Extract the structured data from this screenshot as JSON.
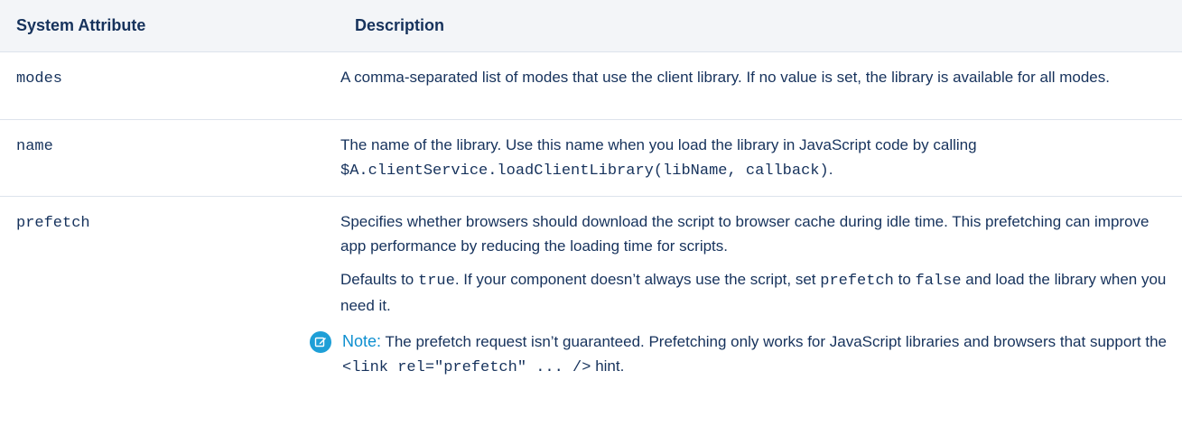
{
  "table": {
    "headers": {
      "attribute": "System Attribute",
      "description": "Description"
    },
    "rows": [
      {
        "attribute": "modes",
        "description": "A comma-separated list of modes that use the client library. If no value is set, the library is available for all modes."
      },
      {
        "attribute": "name",
        "description_text": "The name of the library. Use this name when you load the library in JavaScript code by calling",
        "description_code": "$A.clientService.loadClientLibrary(libName, callback)",
        "description_end": "."
      },
      {
        "attribute": "prefetch",
        "paragraph1": "Specifies whether browsers should download the script to browser cache during idle time. This prefetching can improve app performance by reducing the loading time for scripts.",
        "paragraph2": {
          "text_a": "Defaults to",
          "code_a": "true",
          "text_b": ". If your component doesn’t always use the script, set",
          "code_b": "prefetch",
          "text_c": "to",
          "code_c": "false",
          "text_d": "and load the library when you need it."
        },
        "note": {
          "icon": "note-edit-icon",
          "icon_color": "#1e9fd7",
          "label": "Note:",
          "text_a": "The prefetch request isn’t guaranteed. Prefetching only works for JavaScript libraries and browsers that support the",
          "code": "<link rel=\"prefetch\" ... />",
          "text_b": "hint."
        }
      }
    ]
  },
  "colors": {
    "header_background": "#f3f5f8",
    "text": "#16325c",
    "note_label": "#0e8fd0",
    "row_divider": "#dde3ec"
  }
}
